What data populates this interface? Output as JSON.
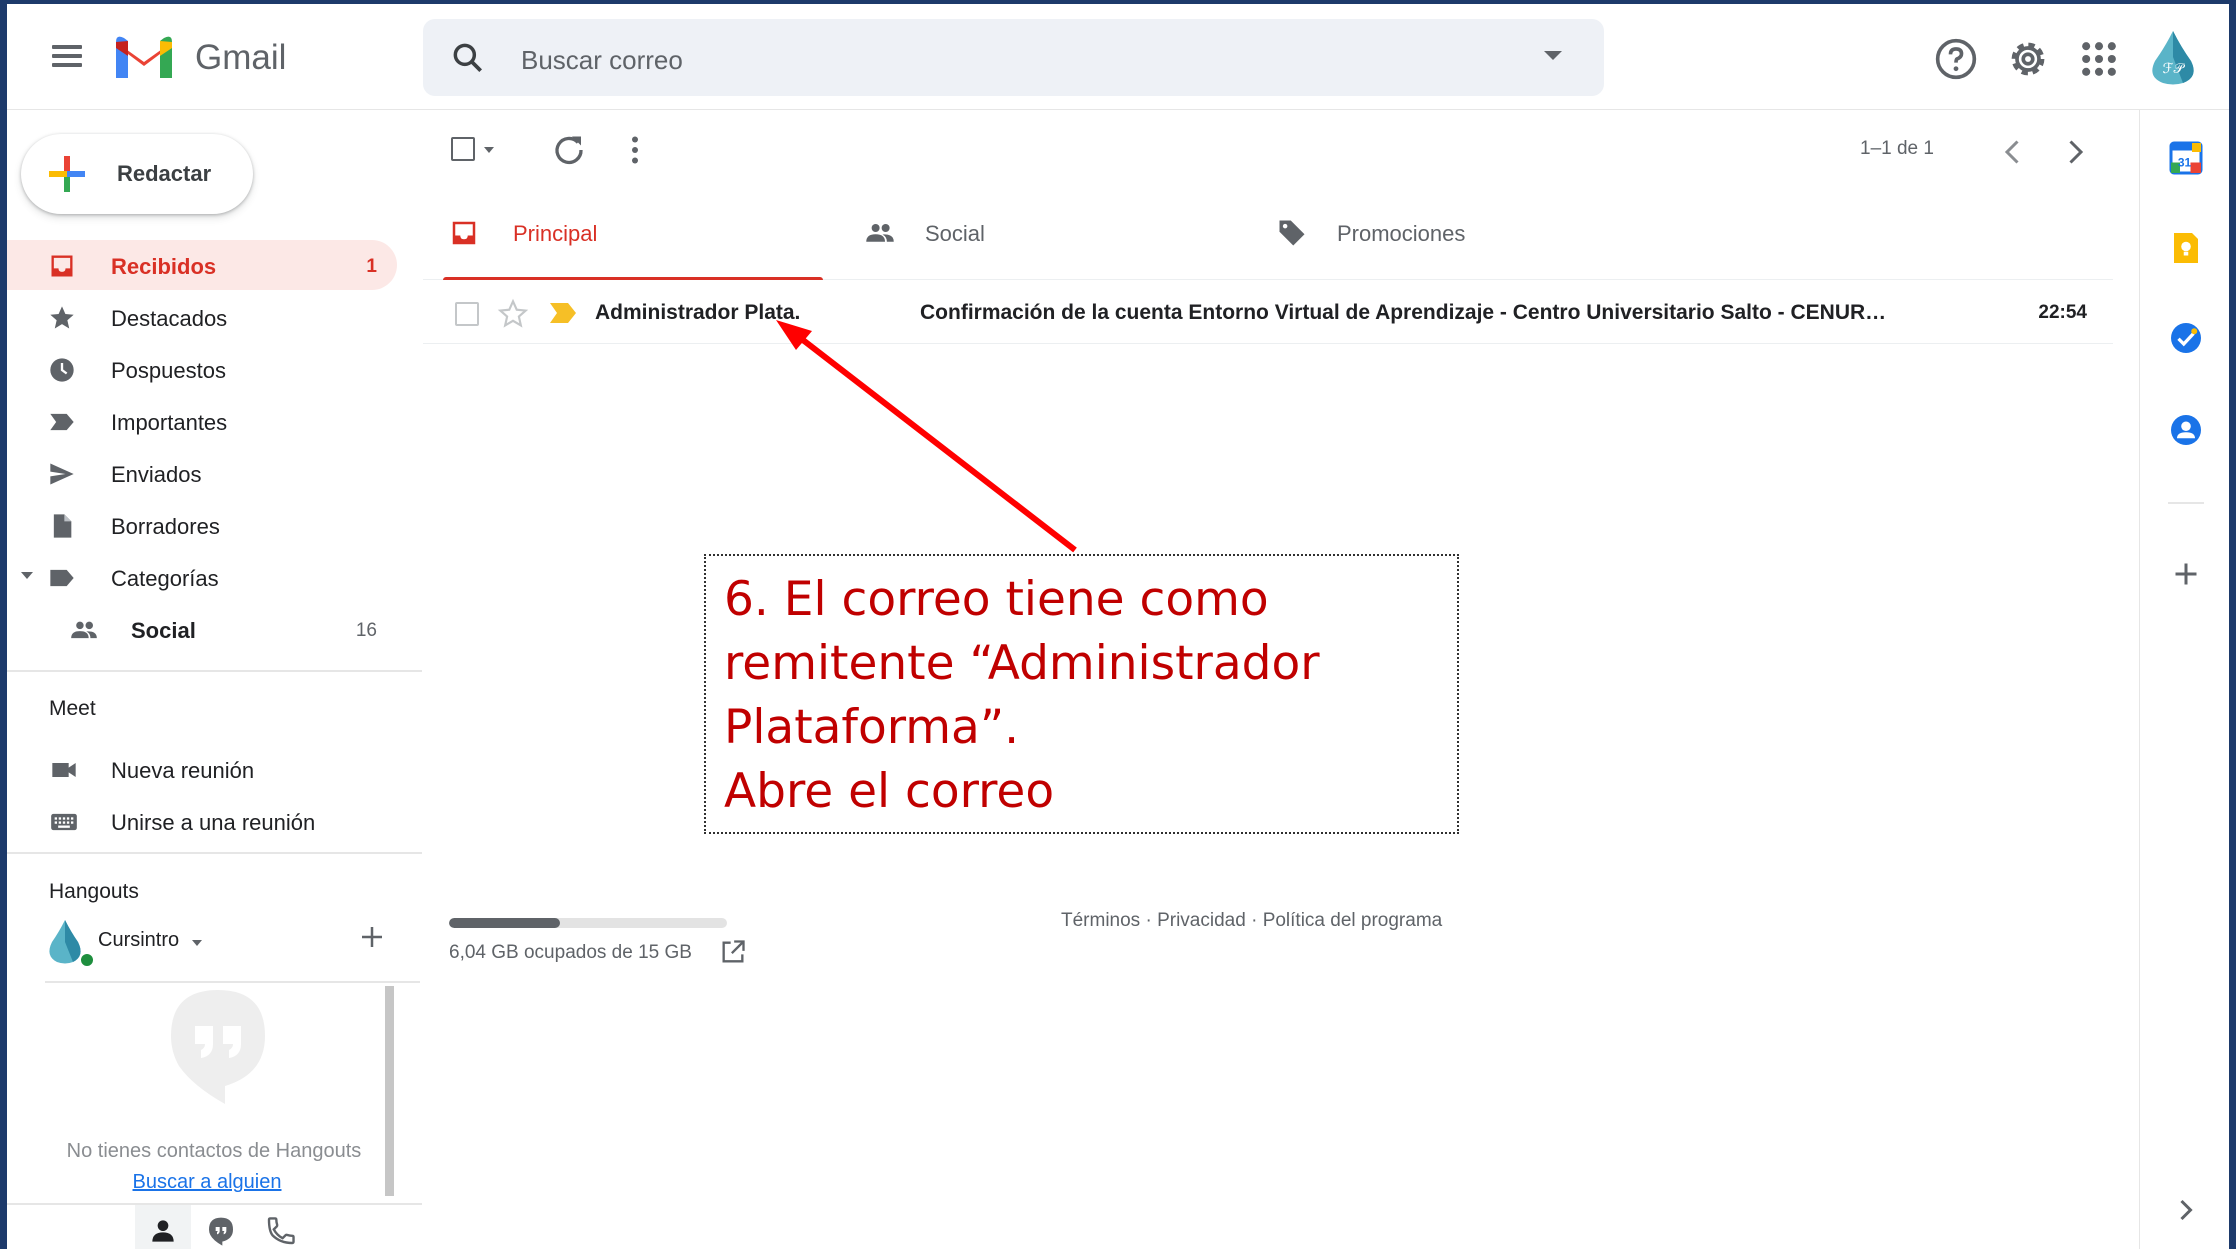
{
  "app": {
    "name": "Gmail"
  },
  "search": {
    "placeholder": "Buscar correo"
  },
  "compose": {
    "label": "Redactar"
  },
  "sidebar": {
    "items": [
      {
        "label": "Recibidos",
        "count": "1",
        "icon": "inbox-icon",
        "active": true
      },
      {
        "label": "Destacados",
        "icon": "star-icon"
      },
      {
        "label": "Pospuestos",
        "icon": "clock-icon"
      },
      {
        "label": "Importantes",
        "icon": "important-icon"
      },
      {
        "label": "Enviados",
        "icon": "send-icon"
      },
      {
        "label": "Borradores",
        "icon": "draft-icon"
      },
      {
        "label": "Categorías",
        "icon": "label-icon"
      },
      {
        "label": "Social",
        "count": "16",
        "icon": "people-icon"
      }
    ]
  },
  "meet": {
    "title": "Meet",
    "items": [
      {
        "label": "Nueva reunión",
        "icon": "video-icon"
      },
      {
        "label": "Unirse a una reunión",
        "icon": "keyboard-icon"
      }
    ]
  },
  "hangouts": {
    "title": "Hangouts",
    "user": "Cursintro",
    "empty_text": "No tienes contactos de Hangouts",
    "search_link": "Buscar a alguien"
  },
  "toolbar": {
    "pagination": "1–1 de 1"
  },
  "tabs": [
    {
      "label": "Principal",
      "icon": "inbox-icon",
      "active": true
    },
    {
      "label": "Social",
      "icon": "people-icon"
    },
    {
      "label": "Promociones",
      "icon": "tag-icon"
    }
  ],
  "emails": [
    {
      "sender": "Administrador Plata.",
      "subject": "Confirmación de la cuenta Entorno Virtual de Aprendizaje - Centro Universitario Salto - CENUR…",
      "time": "22:54"
    }
  ],
  "storage": {
    "text": "6,04 GB ocupados de 15 GB",
    "used_fraction": 0.4
  },
  "footer": {
    "terms": "Términos",
    "privacy": "Privacidad",
    "policy": "Política del programa",
    "sep": "·"
  },
  "annotation": {
    "lines": [
      "6. El correo tiene como",
      "remitente “Administrador",
      "Plataforma”.",
      "Abre el correo"
    ],
    "color": "#c00000"
  },
  "colors": {
    "accent": "#d93025",
    "link": "#1a73e8",
    "active_bg": "#fce8e6"
  }
}
